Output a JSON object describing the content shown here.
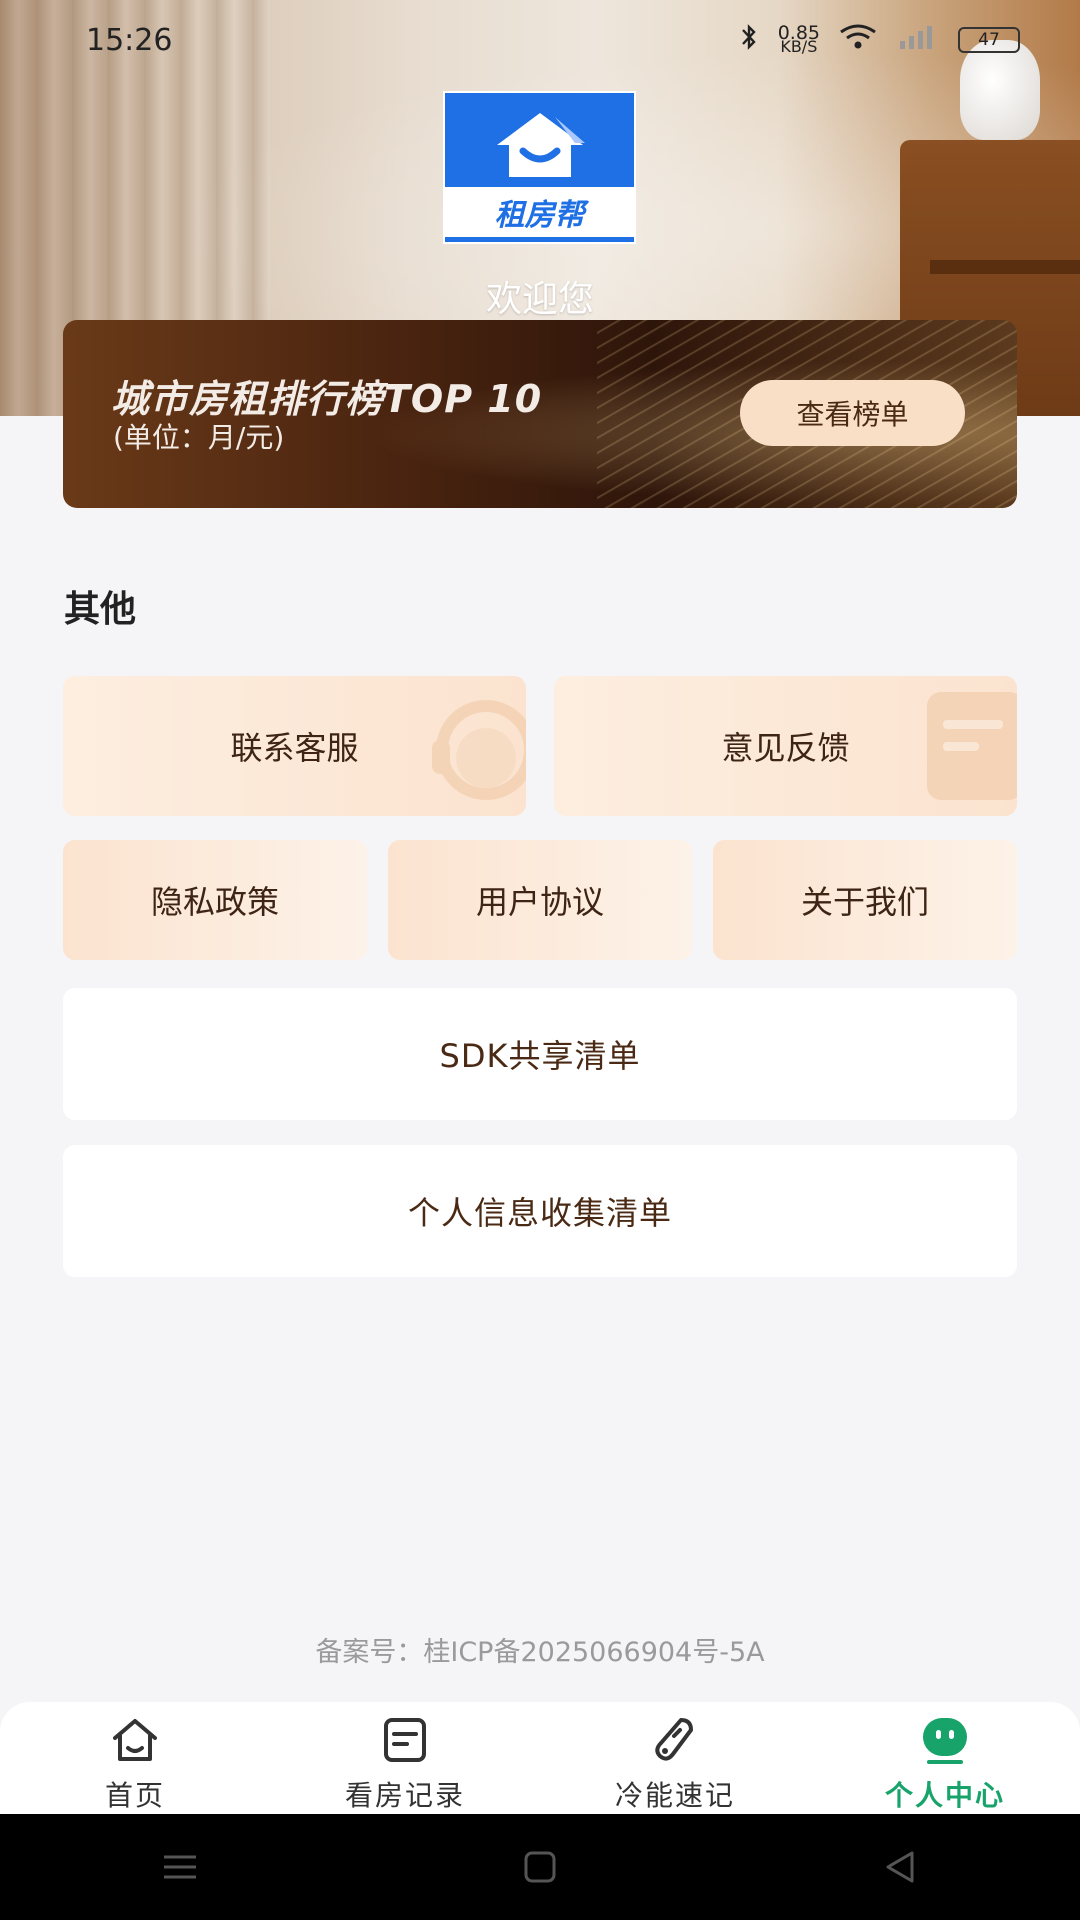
{
  "status_bar": {
    "time": "15:26",
    "net_speed": "0.85",
    "net_unit": "KB/S",
    "battery": "47"
  },
  "header": {
    "logo_text": "租房帮",
    "welcome": "欢迎您"
  },
  "banner": {
    "title": "城市房租排行榜TOP 10",
    "subtitle": "(单位：月/元)",
    "button": "查看榜单"
  },
  "section": {
    "title": "其他"
  },
  "cards": {
    "contact": "联系客服",
    "feedback": "意见反馈",
    "privacy": "隐私政策",
    "agreement": "用户协议",
    "about": "关于我们",
    "sdk": "SDK共享清单",
    "personal_info": "个人信息收集清单"
  },
  "footer": {
    "icp": "备案号：桂ICP备2025066904号-5A"
  },
  "tabbar": {
    "items": [
      {
        "label": "首页",
        "icon": "home-icon"
      },
      {
        "label": "看房记录",
        "icon": "note-icon"
      },
      {
        "label": "冷能速记",
        "icon": "thermometer-icon"
      },
      {
        "label": "个人中心",
        "icon": "profile-icon"
      }
    ],
    "active_color": "#18a36b"
  }
}
